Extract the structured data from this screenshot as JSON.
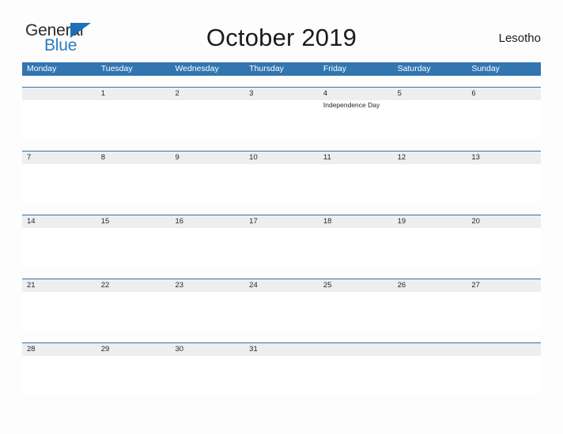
{
  "brand": {
    "name_part1": "General",
    "name_part2": "Blue",
    "triangle_color": "#1d6fb8",
    "blue_text_color": "#2a7ac0"
  },
  "header": {
    "title": "October 2019",
    "country": "Lesotho"
  },
  "theme": {
    "header_blue": "#3175b1",
    "row_divider_blue": "#2e73ad",
    "date_band_gray": "#eeeeee",
    "page_background": "#fdfdfd",
    "text_color": "#262626"
  },
  "calendar": {
    "month": "October",
    "year": "2019",
    "weekday_headers": [
      "Monday",
      "Tuesday",
      "Wednesday",
      "Thursday",
      "Friday",
      "Saturday",
      "Sunday"
    ],
    "weeks": [
      {
        "dates": [
          "",
          "1",
          "2",
          "3",
          "4",
          "5",
          "6"
        ],
        "events": [
          "",
          "",
          "",
          "",
          "Independence Day",
          "",
          ""
        ]
      },
      {
        "dates": [
          "7",
          "8",
          "9",
          "10",
          "11",
          "12",
          "13"
        ],
        "events": [
          "",
          "",
          "",
          "",
          "",
          "",
          ""
        ]
      },
      {
        "dates": [
          "14",
          "15",
          "16",
          "17",
          "18",
          "19",
          "20"
        ],
        "events": [
          "",
          "",
          "",
          "",
          "",
          "",
          ""
        ]
      },
      {
        "dates": [
          "21",
          "22",
          "23",
          "24",
          "25",
          "26",
          "27"
        ],
        "events": [
          "",
          "",
          "",
          "",
          "",
          "",
          ""
        ]
      },
      {
        "dates": [
          "28",
          "29",
          "30",
          "31",
          "",
          "",
          ""
        ],
        "events": [
          "",
          "",
          "",
          "",
          "",
          "",
          ""
        ]
      }
    ]
  }
}
